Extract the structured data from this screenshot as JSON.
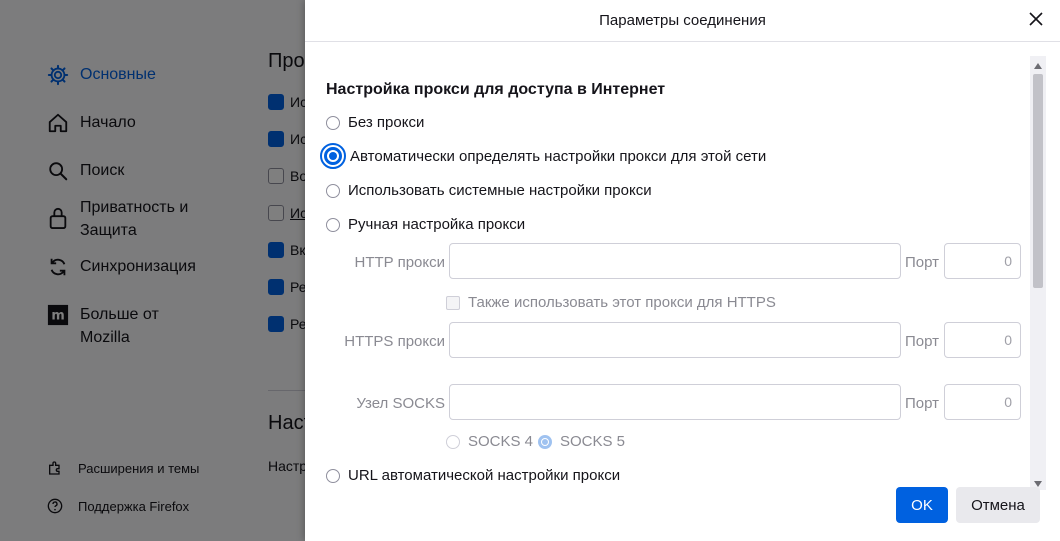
{
  "background": {
    "nav": [
      {
        "label": "Основные",
        "icon": "gear-icon"
      },
      {
        "label": "Начало",
        "icon": "home-icon"
      },
      {
        "label": "Поиск",
        "icon": "search-icon"
      },
      {
        "label": "Приватность и Защита",
        "icon": "lock-icon"
      },
      {
        "label": "Синхронизация",
        "icon": "sync-icon"
      },
      {
        "label": "Больше от Mozilla",
        "icon": "mozilla-icon"
      }
    ],
    "footer": [
      {
        "label": "Расширения и темы",
        "icon": "puzzle-icon"
      },
      {
        "label": "Поддержка Firefox",
        "icon": "help-icon"
      }
    ],
    "fragments": {
      "top_heading": "Про",
      "section_heading": "Наст",
      "section_text": "Настр"
    },
    "checkboxes": [
      {
        "text": "Ис",
        "checked": true
      },
      {
        "text": "Ис",
        "checked": true
      },
      {
        "text": "Во",
        "checked": false
      },
      {
        "text": "Ис",
        "checked": false
      },
      {
        "text": "Вк",
        "checked": true
      },
      {
        "text": "Ре",
        "checked": true
      },
      {
        "text": "Ре",
        "checked": true
      }
    ]
  },
  "dialog": {
    "title": "Параметры соединения",
    "section_title": "Настройка прокси для доступа в Интернет",
    "options": {
      "no_proxy": "Без прокси",
      "auto_detect": "Автоматически определять настройки прокси для этой сети",
      "system": "Использовать системные настройки прокси",
      "manual": "Ручная настройка прокси",
      "pac_url": "URL автоматической настройки прокси"
    },
    "selected_option": "auto_detect",
    "http_label": "HTTP прокси",
    "https_label": "HTTPS прокси",
    "socks_label": "Узел SOCKS",
    "port_label": "Порт",
    "http_port": "0",
    "https_port": "0",
    "socks_port": "0",
    "also_https": "Также использовать этот прокси для HTTPS",
    "socks4": "SOCKS 4",
    "socks5": "SOCKS 5",
    "ok": "OK",
    "cancel": "Отмена"
  },
  "colors": {
    "accent": "#0061e0",
    "overlay": "rgba(0,0,0,0.5)"
  }
}
